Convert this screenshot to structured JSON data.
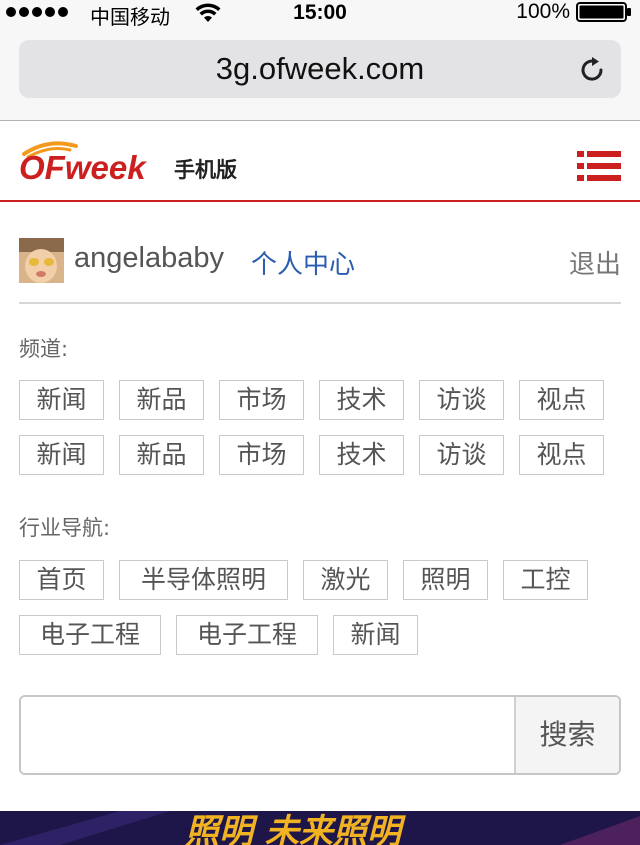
{
  "status_bar": {
    "carrier": "中国移动",
    "time": "15:00",
    "battery_percent": "100%"
  },
  "browser": {
    "url": "3g.ofweek.com",
    "reload_icon": "reload-icon"
  },
  "header": {
    "logo_text": "OFweek",
    "logo_sub": "手机版",
    "menu_icon": "menu-icon",
    "brand_color": "#cc1f1f"
  },
  "user": {
    "username": "angelababy",
    "profile_link": "个人中心",
    "logout": "退出"
  },
  "channels": {
    "label": "频道:",
    "rows": [
      [
        "新闻",
        "新品",
        "市场",
        "技术",
        "访谈",
        "视点"
      ],
      [
        "新闻",
        "新品",
        "市场",
        "技术",
        "访谈",
        "视点"
      ]
    ]
  },
  "industry": {
    "label": "行业导航:",
    "rows": [
      [
        "首页",
        "半导体照明",
        "激光",
        "照明",
        "工控"
      ],
      [
        "电子工程",
        "电子工程",
        "新闻"
      ]
    ]
  },
  "search": {
    "placeholder": "",
    "button": "搜索"
  },
  "banner": {
    "text": "照明 未来照明"
  }
}
